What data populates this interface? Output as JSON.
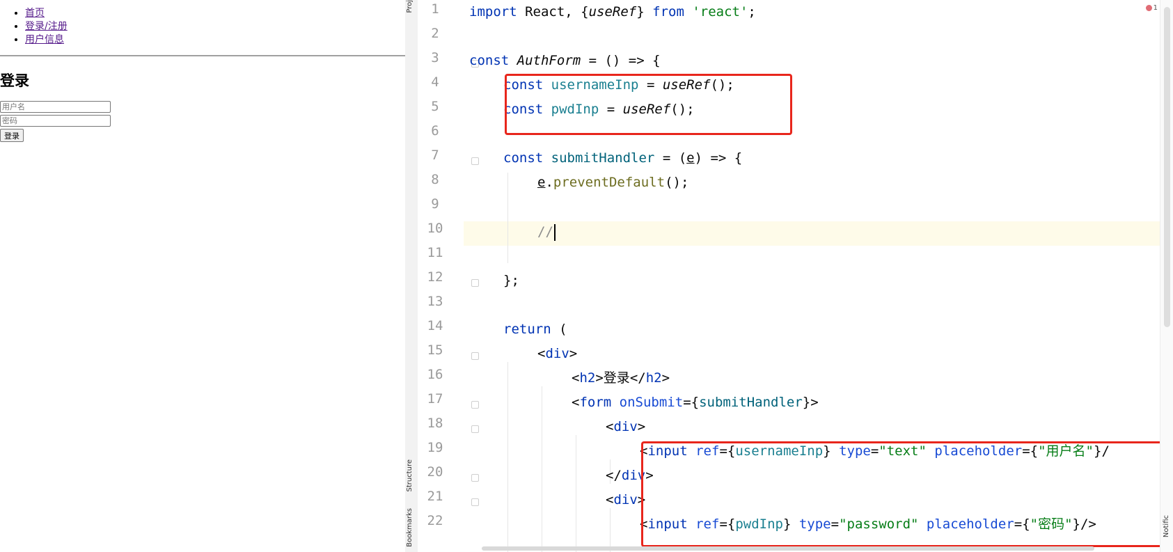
{
  "browser": {
    "nav": [
      "首页",
      "登录/注册",
      "用户信息"
    ],
    "heading": "登录",
    "username_placeholder": "用户名",
    "password_placeholder": "密码",
    "login_button": "登录"
  },
  "ide": {
    "tabs": {
      "project": "Proj",
      "structure": "Structure",
      "bookmarks": "Bookmarks",
      "notifications": "Notific"
    },
    "error_count": "1",
    "line_numbers": [
      "1",
      "2",
      "3",
      "4",
      "5",
      "6",
      "7",
      "8",
      "9",
      "10",
      "11",
      "12",
      "13",
      "14",
      "15",
      "16",
      "17",
      "18",
      "19",
      "20",
      "21",
      "22"
    ],
    "code": {
      "l1": {
        "kw1": "import",
        "t1": " React, {",
        "t2": "useRef",
        "t3": "} ",
        "kw2": "from",
        "sp": " ",
        "str": "'react'",
        "end": ";"
      },
      "l3": {
        "kw": "const",
        "sp": " ",
        "name": "AuthForm",
        "rest": " = () => {"
      },
      "l4": {
        "kw": "const",
        "sp": " ",
        "name": "usernameInp",
        "eq": " = ",
        "fn": "useRef",
        "end": "();"
      },
      "l5": {
        "kw": "const",
        "sp": " ",
        "name": "pwdInp",
        "eq": " = ",
        "fn": "useRef",
        "end": "();"
      },
      "l7": {
        "kw": "const",
        "sp": " ",
        "name": "submitHandler",
        "eq": " = (",
        "param": "e",
        "end": ") => {"
      },
      "l8": {
        "param": "e",
        "dot": ".",
        "method": "preventDefault",
        "end": "();"
      },
      "l10": {
        "comment": "//"
      },
      "l12": {
        "text": "};"
      },
      "l14": {
        "kw": "return",
        "end": " ("
      },
      "l15": {
        "lt": "<",
        "tag": "div",
        "gt": ">"
      },
      "l16": {
        "lt": "<",
        "tag": "h2",
        "gt": ">",
        "text": "登录",
        "lt2": "</",
        "tag2": "h2",
        "gt2": ">"
      },
      "l17": {
        "lt": "<",
        "tag": "form",
        "sp": " ",
        "attr": "onSubmit",
        "eq": "={",
        "val": "submitHandler",
        "end": "}>"
      },
      "l18": {
        "lt": "<",
        "tag": "div",
        "gt": ">"
      },
      "l19": {
        "lt": "<",
        "tag": "input",
        "sp": " ",
        "a1": "ref",
        "e1": "={",
        "v1": "usernameInp",
        "c1": "} ",
        "a2": "type",
        "e2": "=",
        "s2": "\"text\"",
        "sp2": " ",
        "a3": "placeholder",
        "e3": "={",
        "s3": "\"用户名\"",
        "end": "}/"
      },
      "l20": {
        "lt": "</",
        "tag": "div",
        "gt": ">"
      },
      "l21": {
        "lt": "<",
        "tag": "div",
        "gt": ">"
      },
      "l22": {
        "lt": "<",
        "tag": "input",
        "sp": " ",
        "a1": "ref",
        "e1": "={",
        "v1": "pwdInp",
        "c1": "} ",
        "a2": "type",
        "e2": "=",
        "s2": "\"password\"",
        "sp2": " ",
        "a3": "placeholder",
        "e3": "={",
        "s3": "\"密码\"",
        "end": "}/>"
      }
    }
  }
}
